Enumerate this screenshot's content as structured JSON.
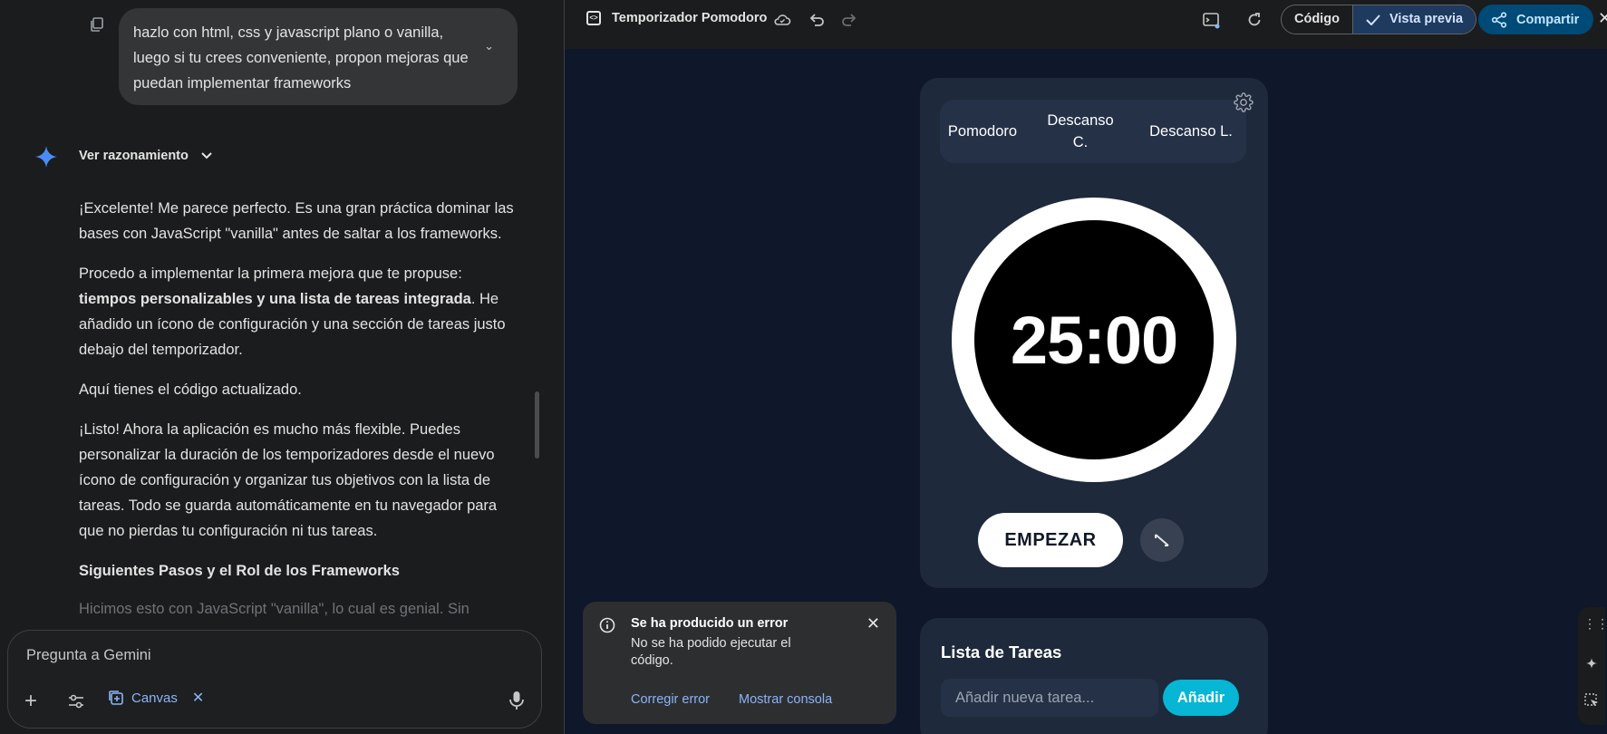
{
  "chat": {
    "user_message": "hazlo con html, css y javascript plano o vanilla, luego si tu crees conveniente, propon mejoras que puedan implementar frameworks",
    "reasoning_label": "Ver razonamiento",
    "p1": "¡Excelente! Me parece perfecto. Es una gran práctica dominar las bases con JavaScript \"vanilla\" antes de saltar a los frameworks.",
    "p2_lead": "Procedo a implementar la primera mejora que te propuse: ",
    "p2_bold": "tiempos personalizables y una lista de tareas integrada",
    "p2_tail": ". He añadido un ícono de configuración y una sección de tareas justo debajo del temporizador.",
    "p3": "Aquí tienes el código actualizado.",
    "p4": "¡Listo! Ahora la aplicación es mucho más flexible. Puedes personalizar la duración de los temporizadores desde el nuevo ícono de configuración y organizar tus objetivos con la lista de tareas. Todo se guarda automáticamente en tu navegador para que no pierdas tu configuración ni tus tareas.",
    "heading": "Siguientes Pasos y el Rol de los Frameworks",
    "p5": "Hicimos esto con JavaScript \"vanilla\", lo cual es genial. Sin"
  },
  "composer": {
    "placeholder": "Pregunta a Gemini",
    "canvas_label": "Canvas"
  },
  "topbar": {
    "title": "Temporizador Pomodoro",
    "code_tab": "Código",
    "preview_tab": "Vista previa",
    "share": "Compartir"
  },
  "timer": {
    "modes": [
      "Pomodoro",
      "Descanso C.",
      "Descanso L."
    ],
    "time": "25:00",
    "start": "EMPEZAR"
  },
  "tasks": {
    "title": "Lista de Tareas",
    "input_placeholder": "Añadir nueva tarea...",
    "add": "Añadir"
  },
  "toast": {
    "title": "Se ha producido un error",
    "message": "No se ha podido ejecutar el código.",
    "fix": "Corregir error",
    "console": "Mostrar consola"
  }
}
